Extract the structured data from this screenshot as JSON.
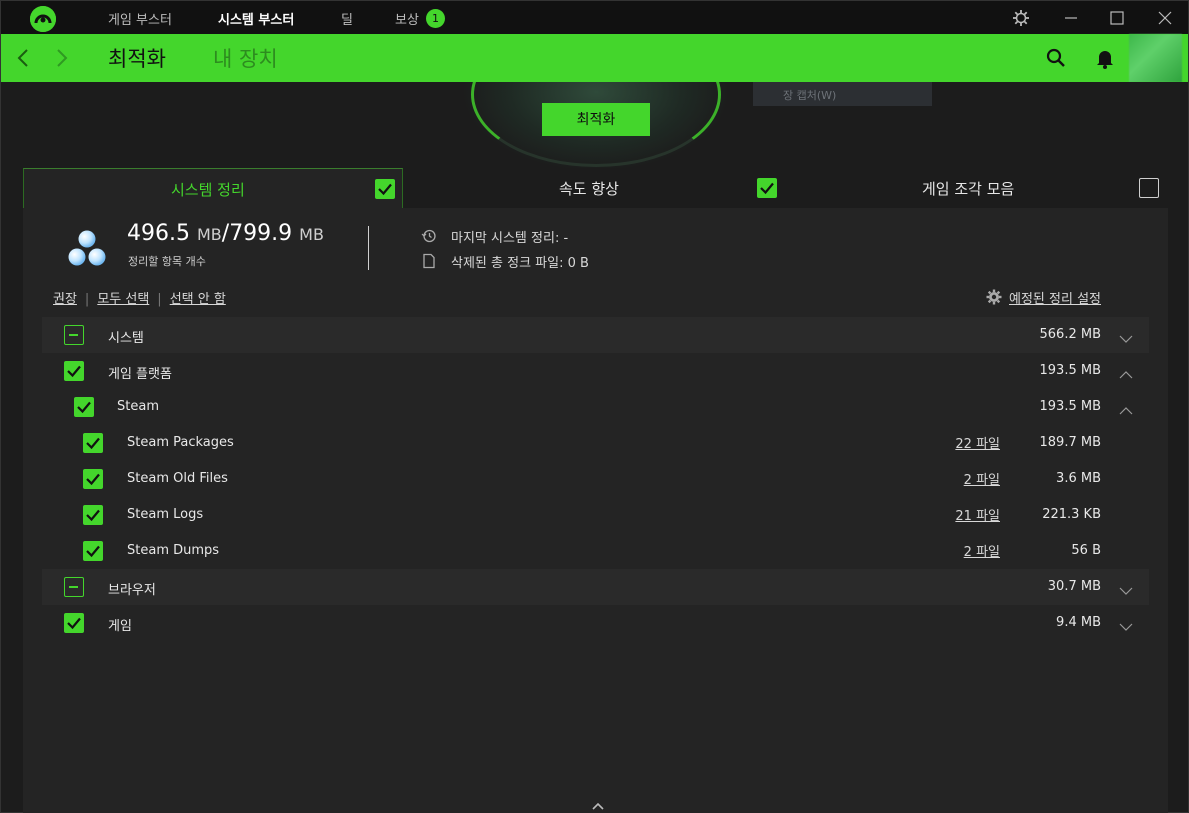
{
  "titlebar": {
    "tabs": [
      {
        "label": "게임 부스터"
      },
      {
        "label": "시스템 부스터"
      },
      {
        "label": "딜"
      },
      {
        "label": "보상"
      }
    ],
    "reward_badge": "1"
  },
  "header": {
    "tabs": [
      {
        "label": "최적화"
      },
      {
        "label": "내 장치"
      }
    ]
  },
  "hero": {
    "optimize_button": "최적화",
    "context_menu_text": "장 캡처(W)"
  },
  "sections": [
    {
      "label": "시스템 정리",
      "checked": true
    },
    {
      "label": "속도 향상",
      "checked": true
    },
    {
      "label": "게임 조각 모음",
      "checked": false
    }
  ],
  "summary": {
    "cleanable": "496.5",
    "cleanable_unit": "MB",
    "total": "799.9",
    "total_unit": "MB",
    "label": "정리할 항목 개수",
    "last_cleanup_label": "마지막 시스템 정리:",
    "last_cleanup_value": "-",
    "deleted_label": "삭제된 총 정크 파일:",
    "deleted_value": "0 B"
  },
  "links": {
    "recommended": "권장",
    "select_all": "모두 선택",
    "select_none": "선택 안 함",
    "scheduled": "예정된 정리 설정"
  },
  "list": [
    {
      "label": "시스템",
      "size": "566.2 MB",
      "files": "",
      "state": "partial",
      "level": 0,
      "expanded": false
    },
    {
      "label": "게임 플랫폼",
      "size": "193.5 MB",
      "files": "",
      "state": "on",
      "level": 0,
      "expanded": true
    },
    {
      "label": "Steam",
      "size": "193.5 MB",
      "files": "",
      "state": "on",
      "level": 1,
      "expanded": true
    },
    {
      "label": "Steam Packages",
      "size": "189.7 MB",
      "files": "22 파일",
      "state": "on",
      "level": 2
    },
    {
      "label": "Steam Old Files",
      "size": "3.6 MB",
      "files": "2 파일",
      "state": "on",
      "level": 2
    },
    {
      "label": "Steam Logs",
      "size": "221.3 KB",
      "files": "21 파일",
      "state": "on",
      "level": 2
    },
    {
      "label": "Steam Dumps",
      "size": "56 B",
      "files": "2 파일",
      "state": "on",
      "level": 2
    },
    {
      "label": "브라우저",
      "size": "30.7 MB",
      "files": "",
      "state": "partial",
      "level": 0,
      "expanded": false
    },
    {
      "label": "게임",
      "size": "9.4 MB",
      "files": "",
      "state": "on",
      "level": 0,
      "expanded": false
    }
  ],
  "colors": {
    "accent": "#44d62c",
    "background": "#1c1c1c",
    "panel": "#242424"
  }
}
